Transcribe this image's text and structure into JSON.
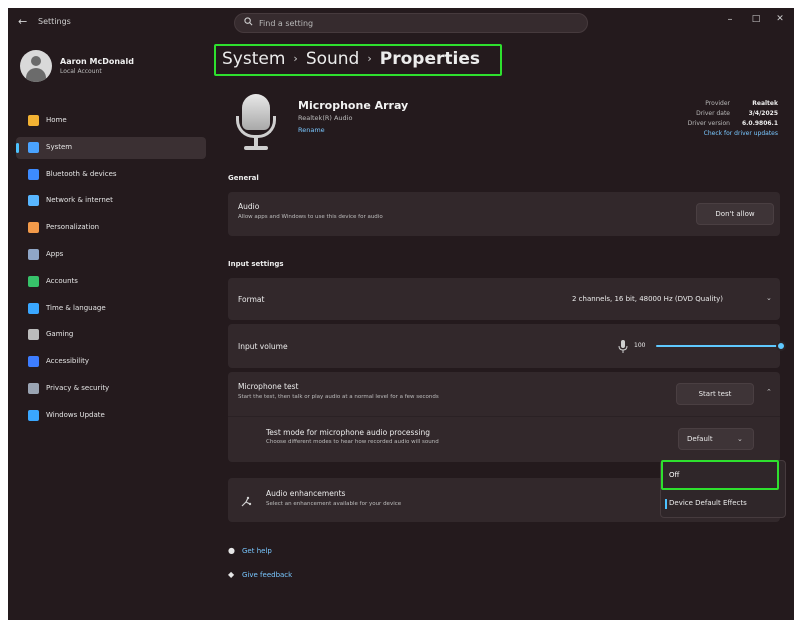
{
  "titlebar": {
    "back_glyph": "←",
    "title": "Settings",
    "search_placeholder": "Find a setting",
    "search_icon": "search-icon",
    "minimize": "–",
    "maximize": "□",
    "close": "✕"
  },
  "profile": {
    "name": "Aaron McDonald",
    "account": "Local Account"
  },
  "sidebar": {
    "items": [
      {
        "label": "Home",
        "icon": "home-icon",
        "color": "#f2b233"
      },
      {
        "label": "System",
        "icon": "system-icon",
        "color": "#4aa3ff",
        "active": true
      },
      {
        "label": "Bluetooth & devices",
        "icon": "bluetooth-icon",
        "color": "#3d8bff"
      },
      {
        "label": "Network & internet",
        "icon": "network-icon",
        "color": "#58b6ff"
      },
      {
        "label": "Personalization",
        "icon": "personalization-icon",
        "color": "#f29a4a"
      },
      {
        "label": "Apps",
        "icon": "apps-icon",
        "color": "#8fa6c7"
      },
      {
        "label": "Accounts",
        "icon": "accounts-icon",
        "color": "#37c26a"
      },
      {
        "label": "Time & language",
        "icon": "time-language-icon",
        "color": "#3aa7ff"
      },
      {
        "label": "Gaming",
        "icon": "gaming-icon",
        "color": "#bcbcbc"
      },
      {
        "label": "Accessibility",
        "icon": "accessibility-icon",
        "color": "#3d7dff"
      },
      {
        "label": "Privacy & security",
        "icon": "shield-icon",
        "color": "#9aa4b3"
      },
      {
        "label": "Windows Update",
        "icon": "windows-update-icon",
        "color": "#3aa7ff"
      }
    ]
  },
  "breadcrumb": {
    "part1": "System",
    "part2": "Sound",
    "current": "Properties",
    "separator": "›"
  },
  "device": {
    "name": "Microphone Array",
    "subtitle": "Realtek(R) Audio",
    "rename": "Rename",
    "provider_label": "Provider",
    "provider_value": "Realtek",
    "date_label": "Driver date",
    "date_value": "3/4/2025",
    "version_label": "Driver version",
    "version_value": "6.0.9806.1",
    "update_link": "Check for driver updates"
  },
  "general": {
    "title": "General",
    "audio_title": "Audio",
    "audio_desc": "Allow apps and Windows to use this device for audio",
    "audio_button": "Don't allow"
  },
  "input": {
    "title": "Input settings",
    "format_label": "Format",
    "format_value": "2 channels, 16 bit, 48000 Hz (DVD Quality)",
    "volume_label": "Input volume",
    "volume_value": "100",
    "volume_level": 1.0,
    "mictest_title": "Microphone test",
    "mictest_desc": "Start the test, then talk or play audio at a normal level for a few seconds",
    "mictest_button": "Start test",
    "testmode_title": "Test mode for microphone audio processing",
    "testmode_desc": "Choose different modes to hear how recorded audio will sound",
    "testmode_value": "Default"
  },
  "enhancements": {
    "title": "Audio enhancements",
    "desc": "Select an enhancement available for your device",
    "options": [
      "Off",
      "Device Default Effects"
    ]
  },
  "footer": {
    "help": "Get help",
    "feedback": "Give feedback"
  }
}
